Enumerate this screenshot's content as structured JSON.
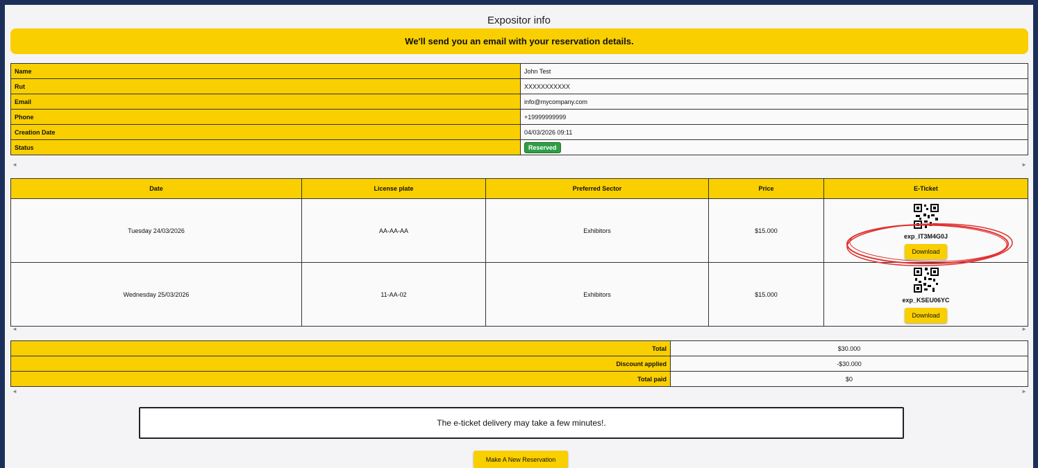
{
  "page": {
    "title": "Expositor info",
    "banner": "We'll send you an email with your reservation details."
  },
  "info": {
    "rows": [
      {
        "key": "Name",
        "value": "John Test"
      },
      {
        "key": "Rut",
        "value": "XXXXXXXXXXX"
      },
      {
        "key": "Email",
        "value": "info@mycompany.com"
      },
      {
        "key": "Phone",
        "value": "+19999999999"
      },
      {
        "key": "Creation Date",
        "value": "04/03/2026 09:11"
      },
      {
        "key": "Status",
        "value": "Reserved"
      }
    ]
  },
  "scroll": {
    "left": "◄",
    "right": "►"
  },
  "tickets": {
    "headers": [
      "Date",
      "License plate",
      "Preferred Sector",
      "Price",
      "E-Ticket"
    ],
    "rows": [
      {
        "date": "Tuesday 24/03/2026",
        "plate": "AA-AA-AA",
        "sector": "Exhibitors",
        "price": "$15.000",
        "code": "exp_IT3M4G0J",
        "download": "Download"
      },
      {
        "date": "Wednesday 25/03/2026",
        "plate": "11-AA-02",
        "sector": "Exhibitors",
        "price": "$15.000",
        "code": "exp_KSEU06YC",
        "download": "Download"
      }
    ]
  },
  "totals": {
    "rows": [
      {
        "key": "Total",
        "value": "$30.000"
      },
      {
        "key": "Discount applied",
        "value": "-$30.000"
      },
      {
        "key": "Total paid",
        "value": "$0"
      }
    ]
  },
  "note": "The e-ticket delivery may take a few minutes!.",
  "new_reservation_label": "Make A New Reservation",
  "colors": {
    "accent": "#f9cf00",
    "background": "#1b2f5a",
    "status": "#2f9e44",
    "annotation": "#e03030"
  },
  "icons": {
    "qr": "qr-code-icon",
    "scroll_left": "scroll-left-arrow-icon",
    "scroll_right": "scroll-right-arrow-icon"
  }
}
